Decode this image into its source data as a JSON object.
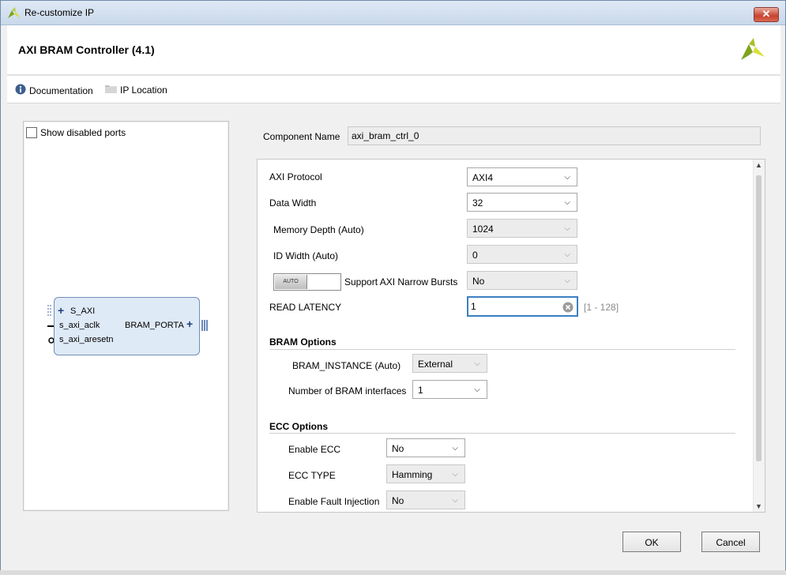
{
  "window": {
    "title": "Re-customize IP",
    "close_glyph": "✕"
  },
  "header": {
    "title": "AXI BRAM Controller (4.1)"
  },
  "toolbar": {
    "documentation": "Documentation",
    "ip_location": "IP Location"
  },
  "left_panel": {
    "show_disabled_ports": "Show disabled ports",
    "ip_symbol": {
      "port_s_axi": "S_AXI",
      "port_aclk": "s_axi_aclk",
      "port_aresetn": "s_axi_aresetn",
      "port_bram": "BRAM_PORTA"
    }
  },
  "component": {
    "label": "Component Name",
    "value": "axi_bram_ctrl_0"
  },
  "params": {
    "axi_protocol": {
      "label": "AXI Protocol",
      "value": "AXI4"
    },
    "data_width": {
      "label": "Data Width",
      "value": "32"
    },
    "memory_depth": {
      "label": "Memory Depth (Auto)",
      "value": "1024"
    },
    "id_width": {
      "label": "ID Width (Auto)",
      "value": "0"
    },
    "narrow_bursts": {
      "toggle": "AUTO",
      "label": "Support AXI Narrow Bursts",
      "value": "No"
    },
    "read_latency": {
      "label": "READ LATENCY",
      "value": "1",
      "range": "[1 - 128]"
    },
    "bram_section": "BRAM Options",
    "bram_instance": {
      "label": "BRAM_INSTANCE (Auto)",
      "value": "External"
    },
    "bram_interfaces": {
      "label": "Number of BRAM interfaces",
      "value": "1"
    },
    "ecc_section": "ECC Options",
    "enable_ecc": {
      "label": "Enable ECC",
      "value": "No"
    },
    "ecc_type": {
      "label": "ECC TYPE",
      "value": "Hamming"
    },
    "fault_injection": {
      "label": "Enable Fault Injection",
      "value": "No"
    }
  },
  "buttons": {
    "ok": "OK",
    "cancel": "Cancel"
  },
  "colors": {
    "accent": "#3c7fc1",
    "ip_block_fill": "#dfeaf7",
    "brand_green": "#7fa31b"
  }
}
